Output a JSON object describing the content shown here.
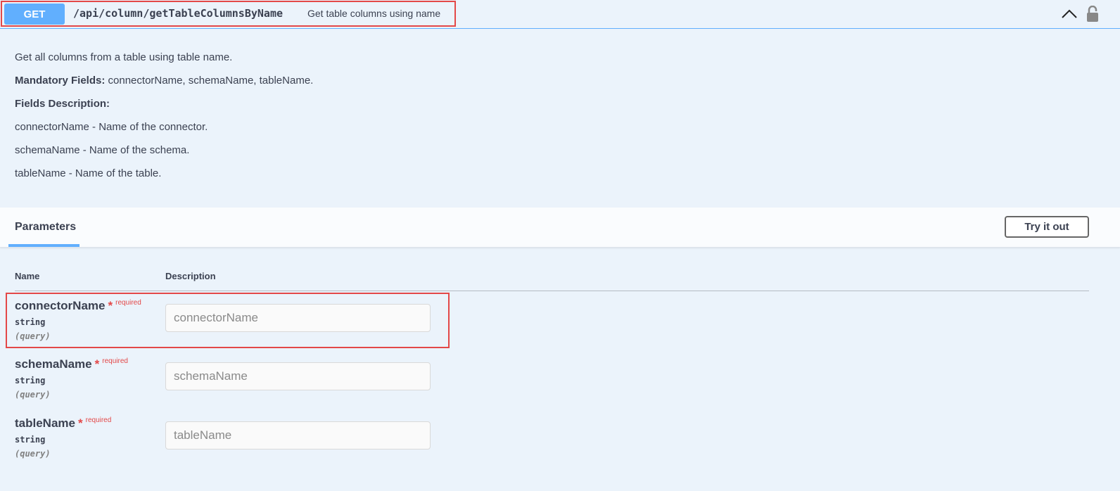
{
  "summary": {
    "method": "GET",
    "path": "/api/column/getTableColumnsByName",
    "description": "Get table columns using name",
    "icons": {
      "collapse": "chevron-up-icon",
      "lock": "lock-icon"
    }
  },
  "description": {
    "line1": "Get all columns from a table using table name.",
    "mandatory_label": "Mandatory Fields:",
    "mandatory_value": " connectorName, schemaName, tableName.",
    "fields_label": "Fields Description:",
    "field1": "connectorName - Name of the connector.",
    "field2": "schemaName - Name of the schema.",
    "field3": "tableName - Name of the table."
  },
  "parameters": {
    "tab_label": "Parameters",
    "try_button": "Try it out",
    "col_name": "Name",
    "col_description": "Description",
    "rows": [
      {
        "name": "connectorName",
        "star": "*",
        "required": "required",
        "type": "string",
        "in": "(query)",
        "placeholder": "connectorName"
      },
      {
        "name": "schemaName",
        "star": "*",
        "required": "required",
        "type": "string",
        "in": "(query)",
        "placeholder": "schemaName"
      },
      {
        "name": "tableName",
        "star": "*",
        "required": "required",
        "type": "string",
        "in": "(query)",
        "placeholder": "tableName"
      }
    ]
  },
  "colors": {
    "get": "#61affe",
    "highlight": "#e34848",
    "background": "#ebf3fb"
  }
}
